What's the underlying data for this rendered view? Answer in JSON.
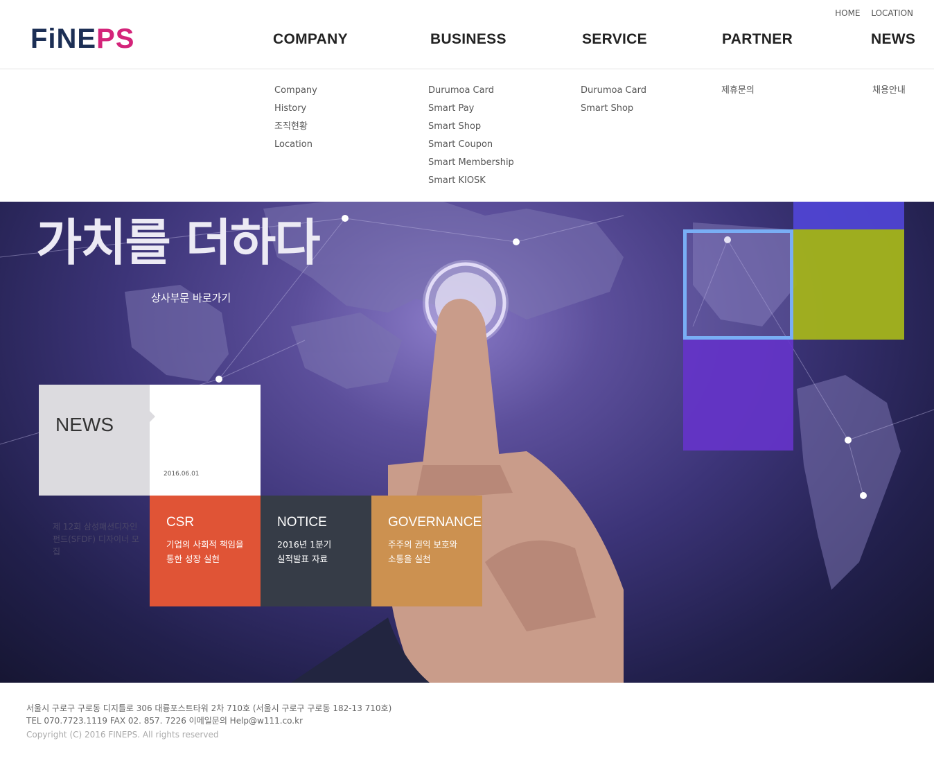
{
  "header": {
    "logo": {
      "part1": "FiNE",
      "part2": "PS"
    },
    "util": [
      "HOME",
      "LOCATION"
    ],
    "gnb": [
      "COMPANY",
      "BUSINESS",
      "SERVICE",
      "PARTNER",
      "NEWS"
    ]
  },
  "submenu": {
    "company": [
      "Company",
      "History",
      "조직현황",
      "Location"
    ],
    "business": [
      "Durumoa Card",
      "Smart Pay",
      "Smart Shop",
      "Smart Coupon",
      "Smart Membership",
      "Smart KIOSK"
    ],
    "service": [
      "Durumoa Card",
      "Smart Shop"
    ],
    "partner": [
      "제휴문의"
    ],
    "news": [
      "채용안내"
    ]
  },
  "hero": {
    "title": "가치를 더하다",
    "link": "상사부문 바로가기"
  },
  "news": {
    "label": "NEWS",
    "date": "2016.06.01",
    "text": "제 12회 삼성패션디자인펀드(SFDF) 디자이너 모집"
  },
  "cards": [
    {
      "title": "CSR",
      "line1": "기업의 사회적 책임을",
      "line2": "통한 성장 실현",
      "color": "#e05436"
    },
    {
      "title": "NOTICE",
      "line1": "2016년 1분기",
      "line2": "실적발표 자료",
      "color": "#363c47"
    },
    {
      "title": "GOVERNANCE",
      "line1": "주주의 권익 보호와",
      "line2": "소통을 실천",
      "color": "#cc9150"
    }
  ],
  "footer": {
    "address": "서울시 구로구 구로동 디지틀로 306 대륭포스트타워 2차 710호 (서울시 구로구 구로동 182-13 710호)",
    "contact": "TEL 070.7723.1119 FAX 02. 857. 7226 이메일문의 Help@w111.co.kr",
    "copyright": "Copyright (C) 2016 FINEPS. All rights reserved"
  }
}
